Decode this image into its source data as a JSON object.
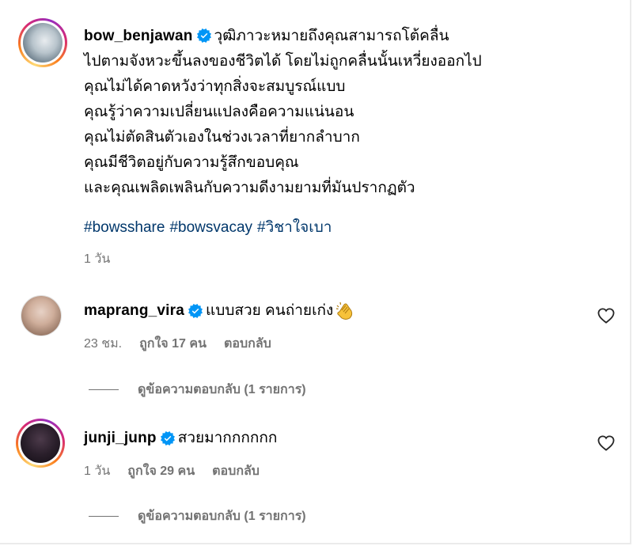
{
  "post": {
    "username": "bow_benjawan",
    "caption_lines": [
      "วุฒิภาวะหมายถึงคุณสามารถโต้คลื่น",
      "ไปตามจังหวะขึ้นลงของชีวิตได้ โดยไม่ถูกคลื่นนั้นเหวี่ยงออกไป",
      "คุณไม่ได้คาดหวังว่าทุกสิ่งจะสมบูรณ์แบบ",
      "คุณรู้ว่าความเปลี่ยนแปลงคือความแน่นอน",
      "คุณไม่ตัดสินตัวเองในช่วงเวลาที่ยากลำบาก",
      "คุณมีชีวิตอยู่กับความรู้สึกขอบคุณ",
      "และคุณเพลิดเพลินกับความดีงามยามที่มันปรากฏตัว"
    ],
    "hashtags": [
      "#bowsshare",
      "#bowsvacay",
      "#วิชาใจเบา"
    ],
    "time": "1 วัน"
  },
  "comments": [
    {
      "username": "maprang_vira",
      "text": "แบบสวย คนถ่ายเก่ง",
      "emoji": "clapping-hands",
      "time": "23 ชม.",
      "likes": "ถูกใจ 17 คน",
      "reply": "ตอบกลับ",
      "view_replies": "ดูข้อความตอบกลับ (1 รายการ)"
    },
    {
      "username": "junji_junp",
      "text": "สวยมากกกกกก",
      "time": "1 วัน",
      "likes": "ถูกใจ 29 คน",
      "reply": "ตอบกลับ",
      "view_replies": "ดูข้อความตอบกลับ (1 รายการ)"
    }
  ],
  "colors": {
    "hashtag": "#00376b",
    "meta": "#737373",
    "verified": "#0095f6"
  },
  "icons": {
    "verified": "verified-badge-icon",
    "like": "heart-outline-icon"
  }
}
